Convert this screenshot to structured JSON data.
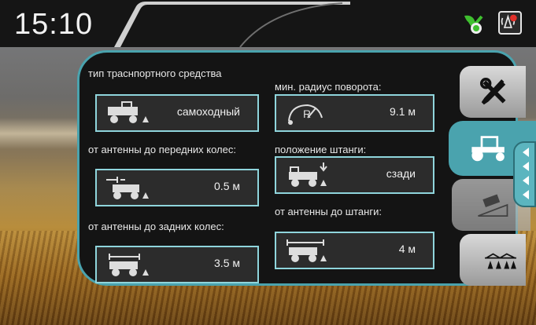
{
  "status": {
    "clock": "15:10"
  },
  "icons": {
    "status_ok": "leaf-check-icon",
    "status_menu": "antenna-warning-icon",
    "tools": "wrench-screwdriver-icon",
    "vehicle": "tractor-icon",
    "tilt": "slope-tractor-icon",
    "boom": "sprayer-boom-icon",
    "expand": "chevron-left-icon"
  },
  "colors": {
    "accent": "#4aa3ae",
    "field_border": "#8fd5dc",
    "ok_green": "#3fbf2f",
    "alert_red": "#e0302a"
  },
  "settings": {
    "vehicle_type": {
      "label": "тип траснпортного средства",
      "value": "самоходный"
    },
    "front_wheels": {
      "label": "от антенны до передних колес:",
      "value": "0.5 м"
    },
    "rear_wheels": {
      "label": "от антенны до задних колес:",
      "value": "3.5 м"
    },
    "turn_radius": {
      "label": "мин. радиус поворота:",
      "value": "9.1 м"
    },
    "boom_position": {
      "label": "положение штанги:",
      "value": "сзади"
    },
    "boom_distance": {
      "label": "от антенны до штанги:",
      "value": "4 м"
    }
  },
  "turn_radius_icon_text": "R"
}
